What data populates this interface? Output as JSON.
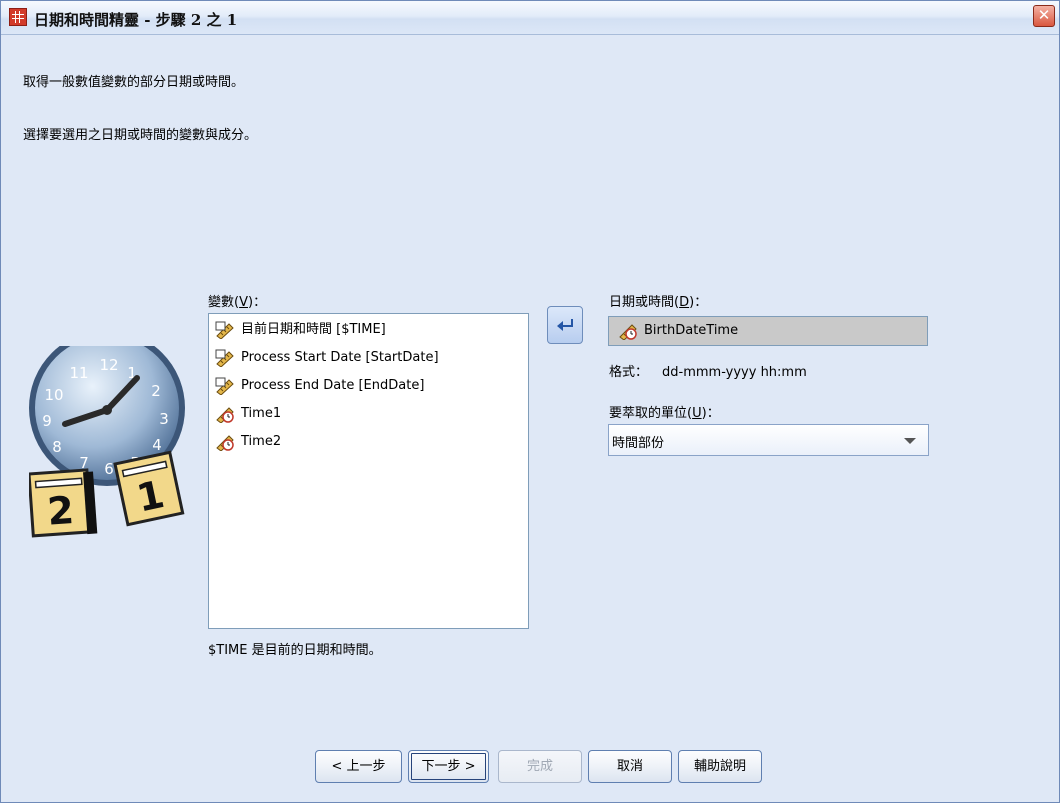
{
  "window": {
    "title": "日期和時間精靈 - 步驟 2 之 1",
    "close_symbol": "✕"
  },
  "instructions": {
    "line1": "取得一般數值變數的部分日期或時間。",
    "line2": "選擇要選用之日期或時間的變數與成分。"
  },
  "variables": {
    "label": "變數",
    "mnemonic": "V",
    "label_suffix": "：",
    "items": [
      {
        "name": "目前日期和時間 [$TIME]",
        "icon": "ruler-date-icon"
      },
      {
        "name": "Process Start Date [StartDate]",
        "icon": "ruler-date-icon"
      },
      {
        "name": "Process End Date [EndDate]",
        "icon": "ruler-date-icon"
      },
      {
        "name": "Time1",
        "icon": "ruler-time-icon"
      },
      {
        "name": "Time2",
        "icon": "ruler-time-icon"
      }
    ],
    "note": "$TIME 是目前的日期和時間。"
  },
  "target": {
    "label": "日期或時間",
    "mnemonic": "D",
    "label_suffix": "：",
    "value": "BirthDateTime",
    "icon": "ruler-time-icon",
    "format_label": "格式：",
    "format_value": "dd-mmm-yyyy hh:mm"
  },
  "unit": {
    "label": "要萃取的單位",
    "mnemonic": "U",
    "label_suffix": "：",
    "selected": "時間部份"
  },
  "buttons": {
    "back": "< 上一步",
    "next": "下一步 >",
    "finish": "完成",
    "cancel": "取消",
    "help": "輔助說明"
  },
  "colors": {
    "dialog_bg": "#dfe8f6",
    "title_accent": "#d23b2b",
    "field_readonly": "#c9c9c9"
  }
}
